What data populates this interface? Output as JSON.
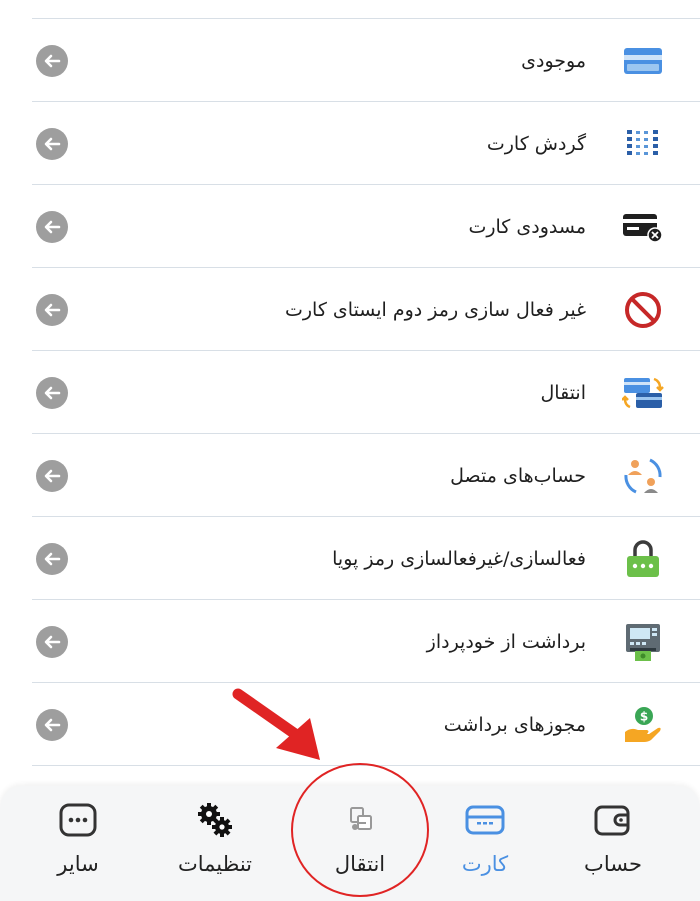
{
  "list": {
    "items": [
      {
        "label": "موجودی",
        "icon": "card-balance-icon"
      },
      {
        "label": "گردش کارت",
        "icon": "card-statement-icon"
      },
      {
        "label": "مسدودی کارت",
        "icon": "card-block-icon"
      },
      {
        "label": "غیر فعال سازی رمز دوم ایستای کارت",
        "icon": "disable-static-pin-icon"
      },
      {
        "label": "انتقال",
        "icon": "card-transfer-icon"
      },
      {
        "label": "حساب‌های متصل",
        "icon": "linked-accounts-icon"
      },
      {
        "label": "فعالسازی/غیرفعالسازی رمز پویا",
        "icon": "dynamic-pin-lock-icon"
      },
      {
        "label": "برداشت از خودپرداز",
        "icon": "atm-withdraw-icon"
      },
      {
        "label": "مجوزهای برداشت",
        "icon": "withdraw-permit-icon"
      }
    ]
  },
  "nav": {
    "account": "حساب",
    "card": "کارت",
    "transfer": "انتقال",
    "settings": "تنظیمات",
    "other": "سایر",
    "active": "card"
  },
  "colors": {
    "accent": "#4a90e2",
    "annotation": "#e02424"
  }
}
